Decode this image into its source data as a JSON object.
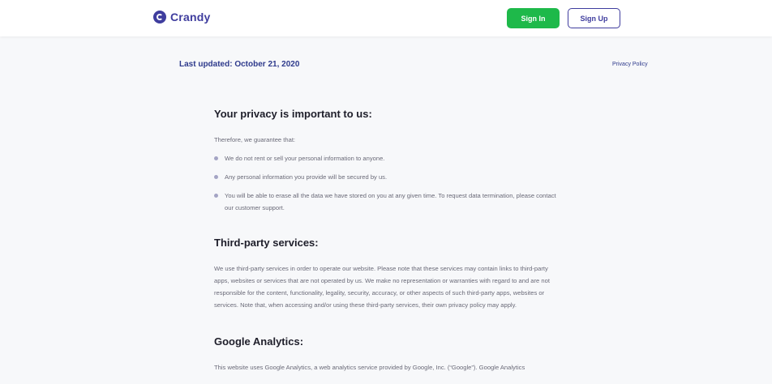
{
  "header": {
    "brand": "Crandy",
    "sign_in": "Sign In",
    "sign_up": "Sign Up"
  },
  "meta": {
    "last_updated": "Last updated: October 21, 2020",
    "breadcrumb": "Privacy Policy"
  },
  "sections": {
    "privacy": {
      "title": "Your privacy is important to us:",
      "intro": "Therefore, we guarantee that:",
      "items": [
        "We do not rent or sell your personal information to anyone.",
        "Any personal information you provide will be secured by us.",
        "You will be able to erase all the data we have stored on you at any given time. To request data termination, please contact our customer support."
      ]
    },
    "third_party": {
      "title": "Third-party services:",
      "text": "We use third-party services in order to operate our website. Please note that these services may contain links to third-party apps, websites or services that are not operated by us. We make no representation or warranties with regard to and are not responsible for the content, functionality, legality, security, accuracy, or other aspects of such third-party apps, websites or services. Note that, when accessing and/or using these third-party services, their own privacy policy may apply."
    },
    "analytics": {
      "title": "Google Analytics:",
      "text": "This website uses Google Analytics, a web analytics service provided by Google, Inc. (“Google”). Google Analytics"
    }
  },
  "colors": {
    "brand": "#3f3d9e",
    "sign_in_bg": "#1eb94a",
    "heading": "#1e1e2a",
    "body_text": "#6a6a78"
  }
}
